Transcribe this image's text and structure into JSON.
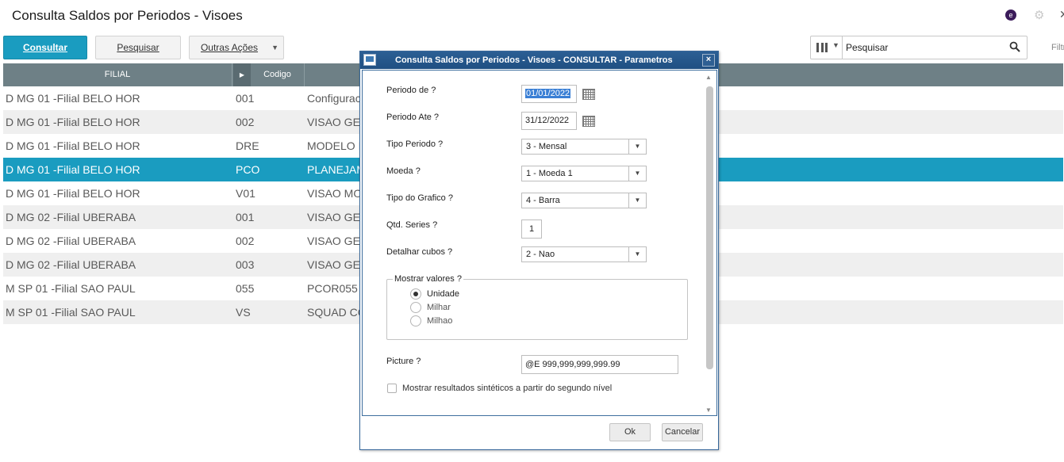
{
  "page": {
    "title": "Consulta Saldos por Periodos - Visoes"
  },
  "toolbar": {
    "consultar": "Consultar",
    "pesquisar": "Pesquisar",
    "outras_acoes": "Outras Ações"
  },
  "search": {
    "placeholder": "Pesquisar",
    "filter_label": "Filtr"
  },
  "grid": {
    "headers": {
      "filial": "FILIAL",
      "codigo": "Codigo"
    },
    "selected_index": 3,
    "rows": [
      {
        "filial": "D MG 01 -Filial BELO HOR",
        "codigo": "001",
        "desc": "Configurac"
      },
      {
        "filial": "D MG 01 -Filial BELO HOR",
        "codigo": "002",
        "desc": "VISAO GE"
      },
      {
        "filial": "D MG 01 -Filial BELO HOR",
        "codigo": "DRE",
        "desc": "MODELO I"
      },
      {
        "filial": "D MG 01 -Filial BELO HOR",
        "codigo": "PCO",
        "desc": "PLANEJAM"
      },
      {
        "filial": "D MG 01 -Filial BELO HOR",
        "codigo": "V01",
        "desc": "VISAO MO"
      },
      {
        "filial": "D MG 02 -Filial UBERABA",
        "codigo": "001",
        "desc": "VISAO GE"
      },
      {
        "filial": "D MG 02 -Filial UBERABA",
        "codigo": "002",
        "desc": "VISAO GE"
      },
      {
        "filial": "D MG 02 -Filial UBERABA",
        "codigo": "003",
        "desc": "VISAO GE"
      },
      {
        "filial": "M SP 01 -Filial SAO PAUL",
        "codigo": "055",
        "desc": "PCOR055"
      },
      {
        "filial": "M SP 01 -Filial SAO PAUL",
        "codigo": "VS",
        "desc": "SQUAD CO"
      }
    ]
  },
  "dialog": {
    "title": "Consulta Saldos por Periodos - Visoes - CONSULTAR - Parametros",
    "close": "×",
    "fields": {
      "periodo_de": {
        "label": "Periodo de ?",
        "value": "01/01/2022"
      },
      "periodo_ate": {
        "label": "Periodo Ate ?",
        "value": "31/12/2022"
      },
      "tipo_periodo": {
        "label": "Tipo Periodo ?",
        "value": "3 - Mensal"
      },
      "moeda": {
        "label": "Moeda ?",
        "value": "1 - Moeda 1"
      },
      "tipo_grafico": {
        "label": "Tipo do Grafico ?",
        "value": "4 - Barra"
      },
      "qtd_series": {
        "label": "Qtd. Series ?",
        "value": "1"
      },
      "detalhar_cubos": {
        "label": "Detalhar cubos ?",
        "value": "2 - Nao"
      },
      "picture": {
        "label": "Picture ?",
        "value": "@E 999,999,999,999.99"
      }
    },
    "mostrar_valores": {
      "legend": "Mostrar valores ?",
      "options": [
        "Unidade",
        "Milhar",
        "Milhao"
      ],
      "selected": "Unidade"
    },
    "checkbox_label": "Mostrar resultados sintéticos a partir do segundo nível",
    "ok": "Ok",
    "cancel": "Cancelar"
  }
}
